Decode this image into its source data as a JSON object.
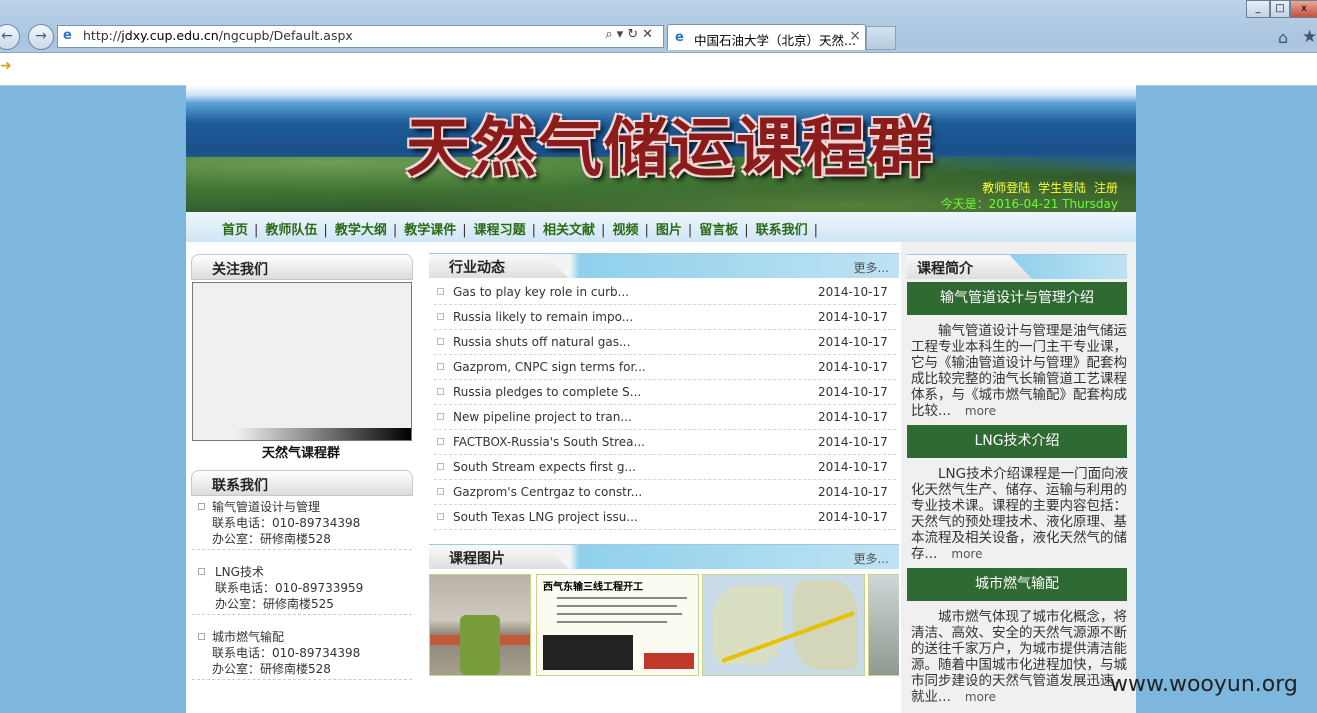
{
  "browser": {
    "url_prefix": "http://",
    "url_domain": "jdxy.cup.edu.cn",
    "url_path": "/ngcupb/Default.aspx",
    "tab_title": "中国石油大学（北京）天然...",
    "tab_close": "×",
    "back": "←",
    "forward": "→",
    "address_tools": "⌕▾↻✕",
    "home_icon": "⌂",
    "favorites_icon": "★"
  },
  "banner": {
    "title": "天然气储运课程群",
    "teacher_login": "教师登陆",
    "student_login": "学生登陆",
    "register": "注册",
    "date": "今天是：2016-04-21  Thursday"
  },
  "nav": {
    "items": [
      "首页",
      "教师队伍",
      "教学大纲",
      "教学课件",
      "课程习题",
      "相关文献",
      "视频",
      "图片",
      "留言板",
      "联系我们"
    ],
    "separator": "|"
  },
  "follow": {
    "heading": "关注我们",
    "caption": "天然气课程群"
  },
  "contact": {
    "heading": "联系我们",
    "items": [
      {
        "name": "输气管道设计与管理",
        "phone": "联系电话：010-89734398",
        "office": "办公室：研修南楼528"
      },
      {
        "name": "LNG技术",
        "phone": "联系电话：010-89733959",
        "office": "办公室：研修南楼525"
      },
      {
        "name": "城市燃气输配",
        "phone": "联系电话：010-89734398",
        "office": "办公室：研修南楼528"
      }
    ]
  },
  "industry_news": {
    "heading": "行业动态",
    "more": "更多...",
    "items": [
      {
        "title": "Gas to play key role in curb...",
        "date": "2014-10-17"
      },
      {
        "title": "Russia likely to remain impo...",
        "date": "2014-10-17"
      },
      {
        "title": "Russia shuts off natural gas...",
        "date": "2014-10-17"
      },
      {
        "title": "Gazprom, CNPC sign terms for...",
        "date": "2014-10-17"
      },
      {
        "title": "Russia pledges to complete S...",
        "date": "2014-10-17"
      },
      {
        "title": "New pipeline project to tran...",
        "date": "2014-10-17"
      },
      {
        "title": "FACTBOX-Russia's South Strea...",
        "date": "2014-10-17"
      },
      {
        "title": "South Stream expects first g...",
        "date": "2014-10-17"
      },
      {
        "title": "Gazprom's Centrgaz to constr...",
        "date": "2014-10-17"
      },
      {
        "title": "South Texas LNG project issu...",
        "date": "2014-10-17"
      }
    ]
  },
  "course_pictures": {
    "heading": "课程图片",
    "more": "更多...",
    "pic2_heading": "西气东输三线工程开工"
  },
  "course_intro": {
    "heading": "课程简介",
    "courses": [
      {
        "name": "输气管道设计与管理介绍",
        "desc": "输气管道设计与管理是油气储运工程专业本科生的一门主干专业课，它与《输油管道设计与管理》配套构成比较完整的油气长输管道工艺课程体系，与《城市燃气输配》配套构成比较...",
        "more": "more"
      },
      {
        "name": "LNG技术介绍",
        "desc": "LNG技术介绍课程是一门面向液化天然气生产、储存、运输与利用的专业技术课。课程的主要内容包括：天然气的预处理技术、液化原理、基本流程及相关设备，液化天然气的储存...",
        "more": "more"
      },
      {
        "name": "城市燃气输配",
        "desc": "城市燃气体现了城市化概念，将清洁、高效、安全的天然气源源不断的送往千家万户，为城市提供清洁能源。随着中国城市化进程加快，与城市同步建设的天然气管道发展迅速，就业...",
        "more": "more"
      }
    ]
  },
  "watermark": "www.wooyun.org"
}
